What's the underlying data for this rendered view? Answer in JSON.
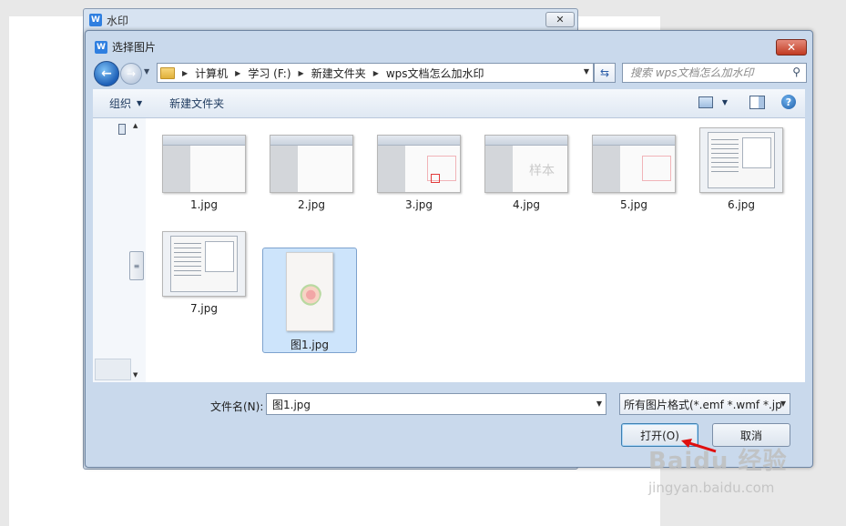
{
  "parent_window": {
    "title": "水印",
    "close_glyph": "✕"
  },
  "dialog": {
    "title": "选择图片",
    "close_glyph": "✕"
  },
  "address": {
    "crumbs": [
      "计算机",
      "学习 (F:)",
      "新建文件夹",
      "wps文档怎么加水印"
    ]
  },
  "search": {
    "placeholder": "搜索 wps文档怎么加水印"
  },
  "toolbar": {
    "organize": "组织",
    "new_folder": "新建文件夹"
  },
  "files": [
    {
      "name": "1.jpg",
      "kind": "screenshot-plain"
    },
    {
      "name": "2.jpg",
      "kind": "screenshot-plain"
    },
    {
      "name": "3.jpg",
      "kind": "screenshot-grid"
    },
    {
      "name": "4.jpg",
      "kind": "screenshot-text-watermark",
      "watermark_text": "样本"
    },
    {
      "name": "5.jpg",
      "kind": "screenshot-grid"
    },
    {
      "name": "6.jpg",
      "kind": "dialog-screenshot"
    },
    {
      "name": "7.jpg",
      "kind": "dialog-screenshot"
    },
    {
      "name": "图1.jpg",
      "kind": "flower-image",
      "selected": true
    }
  ],
  "filename": {
    "label": "文件名(N):",
    "value": "图1.jpg"
  },
  "filter": {
    "value": "所有图片格式(*.emf *.wmf *.jp"
  },
  "buttons": {
    "open": "打开(O)",
    "cancel": "取消"
  },
  "watermark": {
    "line1": "Baidu 经验",
    "line2": "jingyan.baidu.com"
  },
  "colors": {
    "selection": "#cde4fb",
    "dialog_frame": "#c9d9ec",
    "close_button": "#c13b22",
    "annotation_arrow": "#e01010"
  }
}
